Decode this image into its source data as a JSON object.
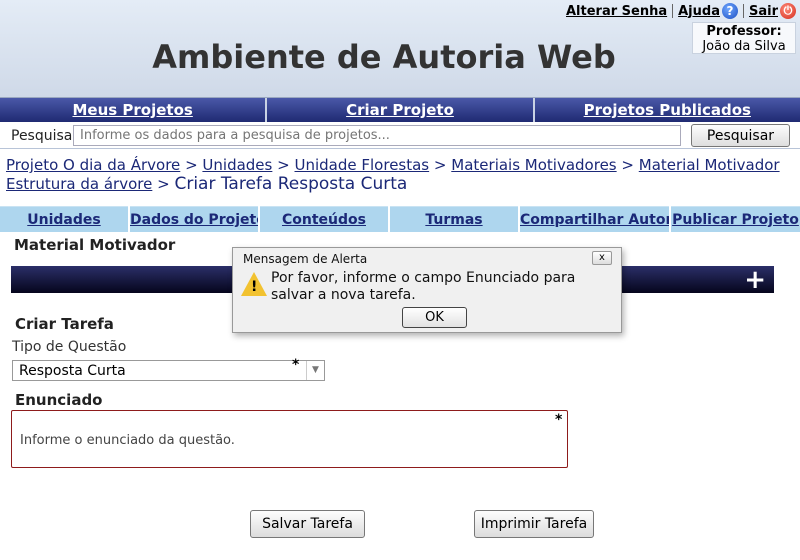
{
  "header": {
    "title": "Ambiente de Autoria Web",
    "links": {
      "change_password": "Alterar Senha",
      "help": "Ajuda",
      "logout": "Sair"
    },
    "professor_label": "Professor:",
    "professor_name": "João da Silva"
  },
  "main_nav": {
    "my_projects": "Meus Projetos",
    "create_project": "Criar Projeto",
    "published_projects": "Projetos Publicados"
  },
  "search": {
    "label": "Pesquisa",
    "placeholder": "Informe os dados para a pesquisa de projetos...",
    "button": "Pesquisar"
  },
  "breadcrumb": {
    "items": [
      "Projeto O dia da Árvore",
      "Unidades",
      "Unidade Florestas",
      "Materiais Motivadores",
      "Material Motivador Estrutura da árvore"
    ],
    "separator": ">",
    "current": "Criar Tarefa Resposta Curta"
  },
  "sub_tabs": [
    "Unidades",
    "Dados do Projeto",
    "Conteúdos",
    "Turmas",
    "Compartilhar Autoria",
    "Publicar Projeto"
  ],
  "content": {
    "material_label": "Material Motivador",
    "add_symbol": "+",
    "create_task_label": "Criar Tarefa",
    "question_type_label": "Tipo de Questão",
    "question_type_value": "Resposta Curta",
    "required_marker": "*",
    "statement_label": "Enunciado",
    "statement_placeholder": "Informe o enunciado da questão.",
    "save_button": "Salvar Tarefa",
    "print_button": "Imprimir Tarefa"
  },
  "alert": {
    "title": "Mensagem de Alerta",
    "close": "x",
    "message": "Por favor, informe o campo Enunciado  para\nsalvar a nova tarefa.",
    "ok": "OK",
    "icon": "warning-icon"
  },
  "colors": {
    "nav_bg": "#2a3587",
    "subtab_bg": "#aed6ee",
    "link": "#1b2877",
    "textarea_border": "#8e1b1b"
  }
}
